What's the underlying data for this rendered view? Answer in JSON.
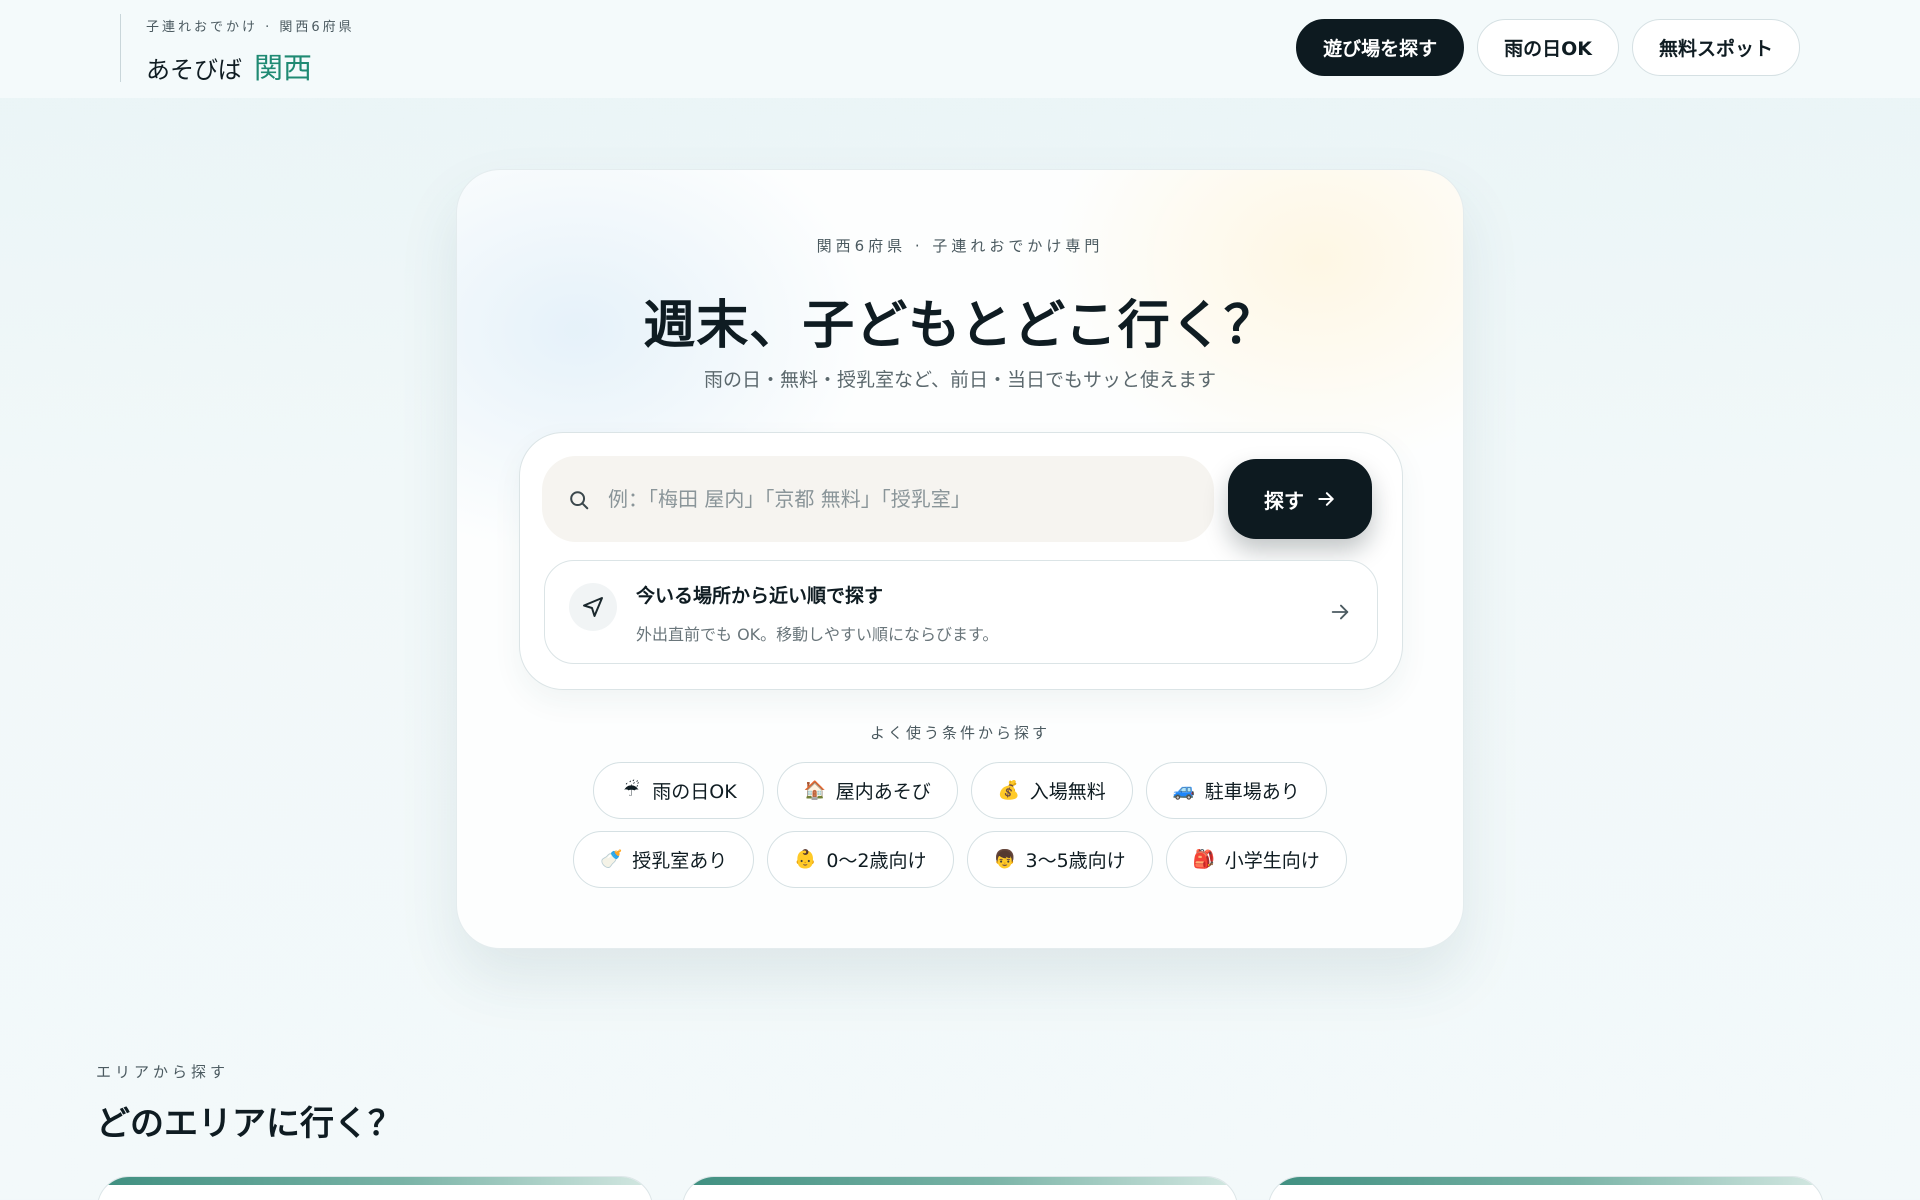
{
  "header": {
    "tagline": "子連れおでかけ · 関西6府県",
    "brand_a": "あそびば",
    "brand_b": "関西",
    "nav": [
      {
        "label": "遊び場を探す",
        "active": true
      },
      {
        "label": "雨の日OK",
        "active": false
      },
      {
        "label": "無料スポット",
        "active": false
      }
    ]
  },
  "hero": {
    "eyebrow": "関西6府県 · 子連れおでかけ専門",
    "title": "週末、子どもとどこ行く？",
    "subtitle": "雨の日・無料・授乳室など、前日・当日でもサッと使えます",
    "search": {
      "placeholder": "例：「梅田 屋内」「京都 無料」「授乳室」",
      "value": "",
      "button_label": "探す"
    },
    "nearby": {
      "title": "今いる場所から近い順で探す",
      "subtitle": "外出直前でも OK。移動しやすい順にならびます。"
    },
    "conditions_label": "よく使う条件から探す",
    "chips_row1": [
      {
        "emoji": "☔",
        "label": "雨の日OK"
      },
      {
        "emoji": "🏠",
        "label": "屋内あそび"
      },
      {
        "emoji": "💰",
        "label": "入場無料"
      },
      {
        "emoji": "🚙",
        "label": "駐車場あり"
      }
    ],
    "chips_row2": [
      {
        "emoji": "🍼",
        "label": "授乳室あり"
      },
      {
        "emoji": "👶",
        "label": "0〜2歳向け"
      },
      {
        "emoji": "👦",
        "label": "3〜5歳向け"
      },
      {
        "emoji": "🎒",
        "label": "小学生向け"
      }
    ]
  },
  "area": {
    "eyebrow": "エリアから探す",
    "title": "どのエリアに行く？"
  },
  "colors": {
    "accent": "#1f8a73",
    "dark": "#0d1a20",
    "background": "#eef6f7"
  }
}
